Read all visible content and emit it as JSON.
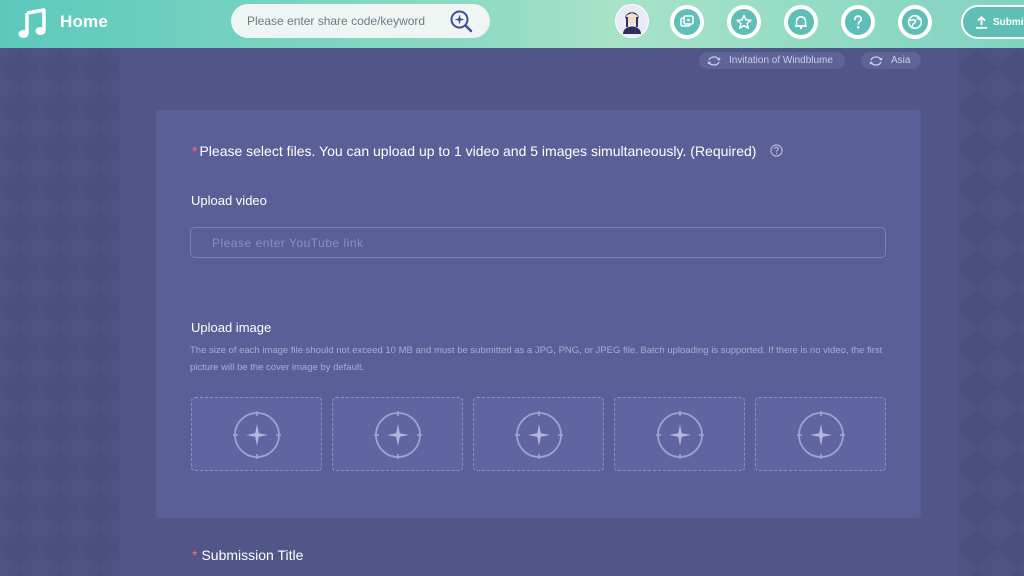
{
  "header": {
    "home_label": "Home",
    "search_placeholder": "Please enter share code/keyword",
    "nav_icons": [
      "screenshot-icon",
      "star-icon",
      "bell-icon",
      "help-icon",
      "globe-icon"
    ],
    "submit_label": "Submit"
  },
  "tags": {
    "event": "Invitation of Windblume",
    "region": "Asia"
  },
  "form": {
    "files_title": "Please select files. You can upload up to 1 video and 5 images simultaneously. (Required)",
    "required_mark": "*",
    "video_label": "Upload video",
    "video_placeholder": "Please enter YouTube link",
    "image_label": "Upload image",
    "image_hint": "The size of each image file should not exceed 10 MB and must be submitted as a JPG, PNG, or JPEG file. Batch uploading is supported. If there is no video, the first picture will be the cover image by default.",
    "image_slots": 5,
    "submission_title_label": "Submission Title"
  },
  "colors": {
    "header_teal": "#5cc9bd",
    "background": "#4a4d7e",
    "card": "#5b5f97",
    "required_red": "#ff6b6b"
  }
}
